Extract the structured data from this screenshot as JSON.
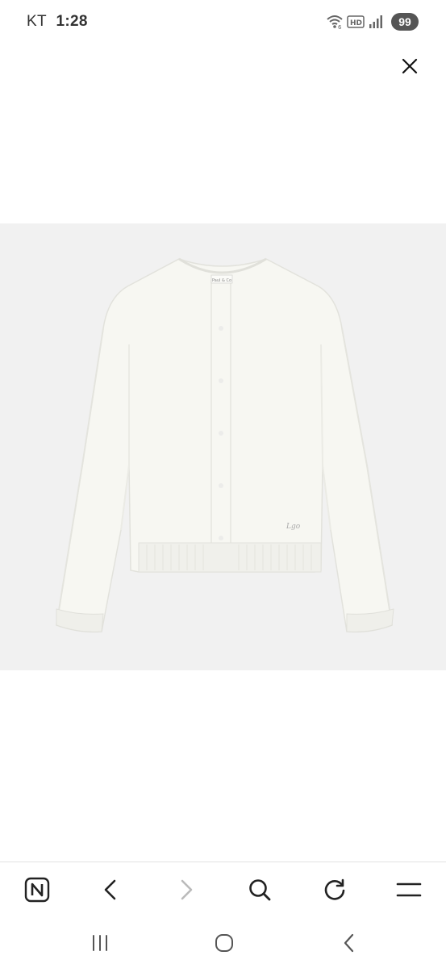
{
  "status_bar": {
    "carrier": "KT",
    "time": "1:28",
    "battery": "99",
    "hd_label": "HD",
    "icons": [
      "wifi-icon",
      "hd-icon",
      "signal-icon"
    ]
  },
  "viewer": {
    "close_icon": "close-icon",
    "background": "#f1f1f1",
    "product": {
      "image": "white-knit-cardigan",
      "label_text": "Paul & Co",
      "logo_text": "Lgo"
    }
  },
  "browser_toolbar": {
    "icons": [
      "naver-home-icon",
      "back-icon",
      "forward-icon",
      "search-icon",
      "refresh-icon",
      "menu-icon"
    ],
    "home_letter": "N"
  },
  "system_nav": {
    "icons": [
      "recent-apps-icon",
      "home-icon",
      "back-icon"
    ]
  }
}
